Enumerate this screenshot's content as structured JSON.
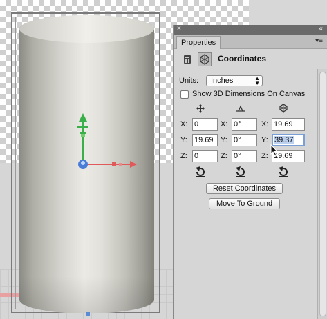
{
  "panel": {
    "close_glyph": "×",
    "collapse_glyph": "«",
    "tab_label": "Properties",
    "menu_glyph": "▾≡",
    "header_title": "Coordinates",
    "units_label": "Units:",
    "units_value": "Inches",
    "show3d_label": "Show 3D Dimensions On Canvas",
    "show3d_checked": false,
    "position": {
      "x_label": "X:",
      "x": "0",
      "y_label": "Y:",
      "y": "19.69",
      "z_label": "Z:",
      "z": "0"
    },
    "rotation": {
      "x_label": "X:",
      "x": "0°",
      "y_label": "Y:",
      "y": "0°",
      "z_label": "Z:",
      "z": "0°"
    },
    "scale": {
      "x_label": "X:",
      "x": "19.69",
      "y_label": "Y:",
      "y": "39.37",
      "z_label": "Z:",
      "z": "19.69"
    },
    "reset_coordinates_label": "Reset Coordinates",
    "move_to_ground_label": "Move To Ground"
  },
  "colors": {
    "accent_focus": "#7a9ed6",
    "gizmo_green": "#3bb04a",
    "gizmo_red": "#e05a5a",
    "gizmo_blue": "#4a7ed6"
  },
  "icons": [
    "calculator-icon",
    "coordinates-icon",
    "move-icon",
    "rotate-icon",
    "scale-icon",
    "reset-icon",
    "cursor-icon"
  ]
}
